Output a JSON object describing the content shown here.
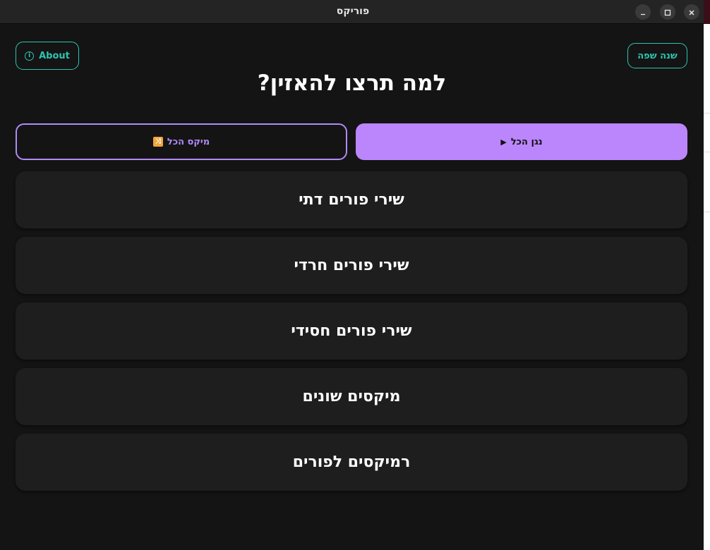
{
  "window": {
    "title": "פוריקס"
  },
  "header": {
    "about_label": "About",
    "language_label": "שנה שפה",
    "heading": "למה תרצו להאזין?"
  },
  "actions": {
    "play_all_label": "נגן הכל",
    "mix_all_label": "מיקס הכל"
  },
  "categories": [
    {
      "label": "שירי פורים דתי"
    },
    {
      "label": "שירי פורים חרדי"
    },
    {
      "label": "שירי פורים חסידי"
    },
    {
      "label": "מיקסים שונים"
    },
    {
      "label": "רמיקסים לפורים"
    }
  ],
  "colors": {
    "accent_purple": "#bb86fc",
    "accent_teal": "#2ec4b0",
    "background": "#141414",
    "card": "#1e1e1e"
  },
  "icons": {
    "about": "info-icon",
    "play": "play-icon",
    "mix": "shuffle-icon",
    "minimize": "minimize-icon",
    "maximize": "maximize-icon",
    "close": "close-icon"
  }
}
